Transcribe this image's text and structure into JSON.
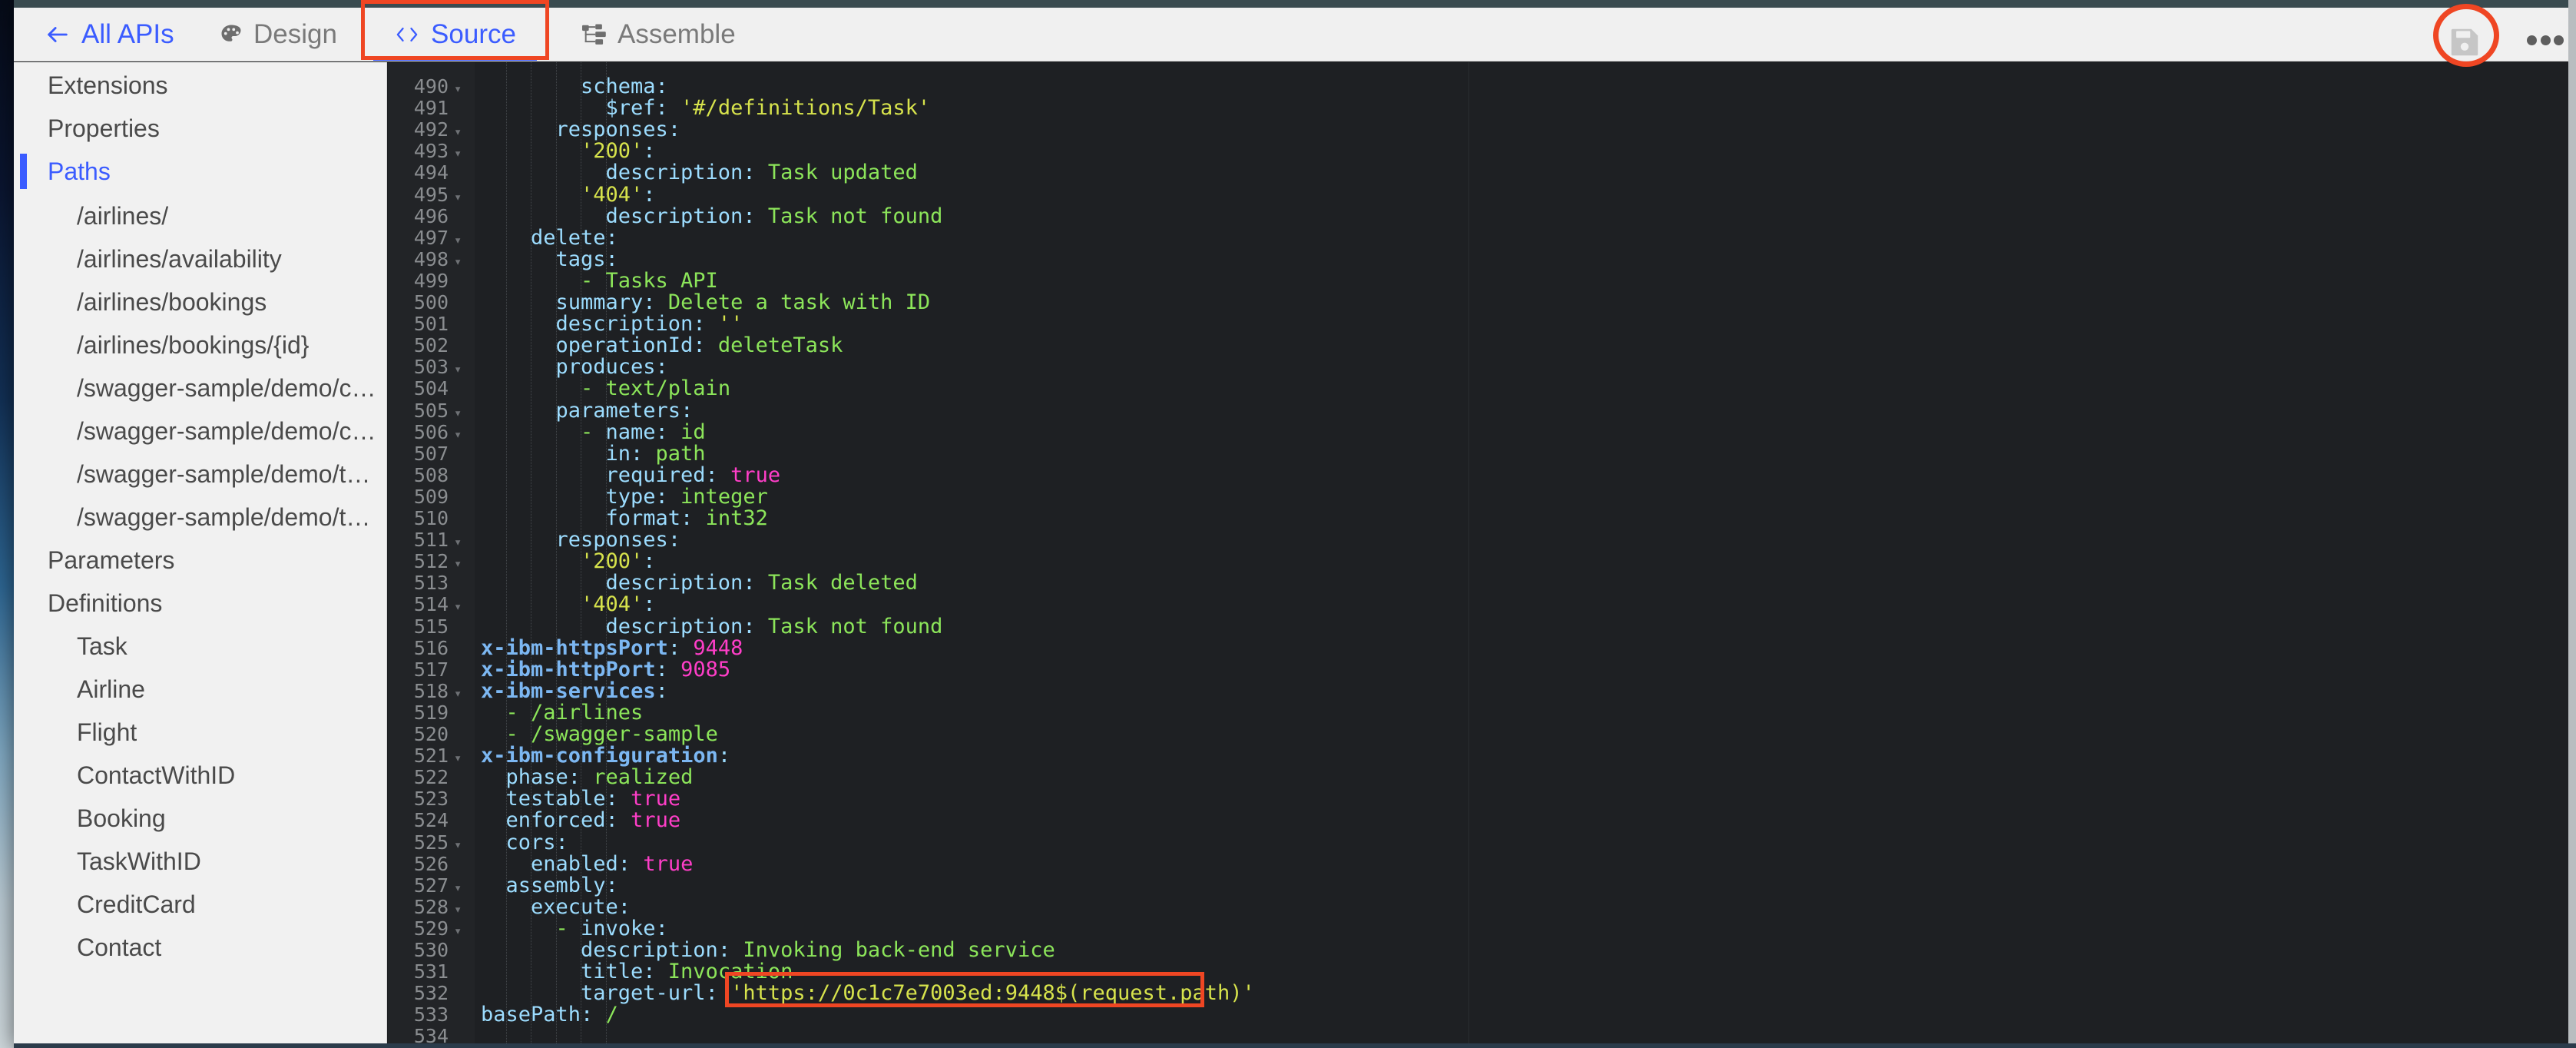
{
  "header": {
    "back_label": "All APIs",
    "tabs": [
      {
        "label": "Design",
        "icon": "palette-icon",
        "active": false
      },
      {
        "label": "Source",
        "icon": "code-icon",
        "active": true
      },
      {
        "label": "Assemble",
        "icon": "sitemap-icon",
        "active": false
      }
    ],
    "save_icon": "save-icon",
    "more_icon": "more-options-icon",
    "accent_color": "#3b5cff",
    "annotation_color": "#ef4623"
  },
  "sidebar": {
    "items": [
      {
        "label": "Extensions",
        "level": 1,
        "selected": false
      },
      {
        "label": "Properties",
        "level": 1,
        "selected": false
      },
      {
        "label": "Paths",
        "level": 1,
        "selected": true
      },
      {
        "label": "/airlines/",
        "level": 2,
        "selected": false
      },
      {
        "label": "/airlines/availability",
        "level": 2,
        "selected": false
      },
      {
        "label": "/airlines/bookings",
        "level": 2,
        "selected": false
      },
      {
        "label": "/airlines/bookings/{id}",
        "level": 2,
        "selected": false
      },
      {
        "label": "/swagger-sample/demo/contacts",
        "level": 2,
        "selected": false
      },
      {
        "label": "/swagger-sample/demo/contac…",
        "level": 2,
        "selected": false
      },
      {
        "label": "/swagger-sample/demo/tasks",
        "level": 2,
        "selected": false
      },
      {
        "label": "/swagger-sample/demo/tasks/{…",
        "level": 2,
        "selected": false
      },
      {
        "label": "Parameters",
        "level": 1,
        "selected": false
      },
      {
        "label": "Definitions",
        "level": 1,
        "selected": false
      },
      {
        "label": "Task",
        "level": 2,
        "selected": false
      },
      {
        "label": "Airline",
        "level": 2,
        "selected": false
      },
      {
        "label": "Flight",
        "level": 2,
        "selected": false
      },
      {
        "label": "ContactWithID",
        "level": 2,
        "selected": false
      },
      {
        "label": "Booking",
        "level": 2,
        "selected": false
      },
      {
        "label": "TaskWithID",
        "level": 2,
        "selected": false
      },
      {
        "label": "CreditCard",
        "level": 2,
        "selected": false
      },
      {
        "label": "Contact",
        "level": 2,
        "selected": false
      }
    ]
  },
  "editor": {
    "language": "yaml",
    "first_line": 490,
    "last_line": 534,
    "highlighted_value": "'https://0c1c7e7003ed:9448$(request.path)'",
    "lines": [
      {
        "n": 490,
        "fold": true,
        "indent": 4,
        "tokens": [
          [
            "k",
            "schema"
          ],
          [
            "p",
            ":"
          ]
        ]
      },
      {
        "n": 491,
        "fold": false,
        "indent": 5,
        "tokens": [
          [
            "k",
            "$ref"
          ],
          [
            "p",
            ": "
          ],
          [
            "q",
            "'#/definitions/Task'"
          ]
        ]
      },
      {
        "n": 492,
        "fold": true,
        "indent": 3,
        "tokens": [
          [
            "k",
            "responses"
          ],
          [
            "p",
            ":"
          ]
        ]
      },
      {
        "n": 493,
        "fold": true,
        "indent": 4,
        "tokens": [
          [
            "q",
            "'200'"
          ],
          [
            "p",
            ":"
          ]
        ]
      },
      {
        "n": 494,
        "fold": false,
        "indent": 5,
        "tokens": [
          [
            "k",
            "description"
          ],
          [
            "p",
            ": "
          ],
          [
            "s",
            "Task updated"
          ]
        ]
      },
      {
        "n": 495,
        "fold": true,
        "indent": 4,
        "tokens": [
          [
            "q",
            "'404'"
          ],
          [
            "p",
            ":"
          ]
        ]
      },
      {
        "n": 496,
        "fold": false,
        "indent": 5,
        "tokens": [
          [
            "k",
            "description"
          ],
          [
            "p",
            ": "
          ],
          [
            "s",
            "Task not found"
          ]
        ]
      },
      {
        "n": 497,
        "fold": true,
        "indent": 2,
        "tokens": [
          [
            "k",
            "delete"
          ],
          [
            "p",
            ":"
          ]
        ]
      },
      {
        "n": 498,
        "fold": true,
        "indent": 3,
        "tokens": [
          [
            "k",
            "tags"
          ],
          [
            "p",
            ":"
          ]
        ]
      },
      {
        "n": 499,
        "fold": false,
        "indent": 4,
        "tokens": [
          [
            "d",
            "- "
          ],
          [
            "s",
            "Tasks API"
          ]
        ]
      },
      {
        "n": 500,
        "fold": false,
        "indent": 3,
        "tokens": [
          [
            "k",
            "summary"
          ],
          [
            "p",
            ": "
          ],
          [
            "s",
            "Delete a task with ID"
          ]
        ]
      },
      {
        "n": 501,
        "fold": false,
        "indent": 3,
        "tokens": [
          [
            "k",
            "description"
          ],
          [
            "p",
            ": "
          ],
          [
            "q",
            "''"
          ]
        ]
      },
      {
        "n": 502,
        "fold": false,
        "indent": 3,
        "tokens": [
          [
            "k",
            "operationId"
          ],
          [
            "p",
            ": "
          ],
          [
            "s",
            "deleteTask"
          ]
        ]
      },
      {
        "n": 503,
        "fold": true,
        "indent": 3,
        "tokens": [
          [
            "k",
            "produces"
          ],
          [
            "p",
            ":"
          ]
        ]
      },
      {
        "n": 504,
        "fold": false,
        "indent": 4,
        "tokens": [
          [
            "d",
            "- "
          ],
          [
            "s",
            "text/plain"
          ]
        ]
      },
      {
        "n": 505,
        "fold": true,
        "indent": 3,
        "tokens": [
          [
            "k",
            "parameters"
          ],
          [
            "p",
            ":"
          ]
        ]
      },
      {
        "n": 506,
        "fold": true,
        "indent": 4,
        "tokens": [
          [
            "d",
            "- "
          ],
          [
            "k",
            "name"
          ],
          [
            "p",
            ": "
          ],
          [
            "s",
            "id"
          ]
        ]
      },
      {
        "n": 507,
        "fold": false,
        "indent": 5,
        "tokens": [
          [
            "k",
            "in"
          ],
          [
            "p",
            ": "
          ],
          [
            "s",
            "path"
          ]
        ]
      },
      {
        "n": 508,
        "fold": false,
        "indent": 5,
        "tokens": [
          [
            "k",
            "required"
          ],
          [
            "p",
            ": "
          ],
          [
            "n",
            "true"
          ]
        ]
      },
      {
        "n": 509,
        "fold": false,
        "indent": 5,
        "tokens": [
          [
            "k",
            "type"
          ],
          [
            "p",
            ": "
          ],
          [
            "s",
            "integer"
          ]
        ]
      },
      {
        "n": 510,
        "fold": false,
        "indent": 5,
        "tokens": [
          [
            "k",
            "format"
          ],
          [
            "p",
            ": "
          ],
          [
            "s",
            "int32"
          ]
        ]
      },
      {
        "n": 511,
        "fold": true,
        "indent": 3,
        "tokens": [
          [
            "k",
            "responses"
          ],
          [
            "p",
            ":"
          ]
        ]
      },
      {
        "n": 512,
        "fold": true,
        "indent": 4,
        "tokens": [
          [
            "q",
            "'200'"
          ],
          [
            "p",
            ":"
          ]
        ]
      },
      {
        "n": 513,
        "fold": false,
        "indent": 5,
        "tokens": [
          [
            "k",
            "description"
          ],
          [
            "p",
            ": "
          ],
          [
            "s",
            "Task deleted"
          ]
        ]
      },
      {
        "n": 514,
        "fold": true,
        "indent": 4,
        "tokens": [
          [
            "q",
            "'404'"
          ],
          [
            "p",
            ":"
          ]
        ]
      },
      {
        "n": 515,
        "fold": false,
        "indent": 5,
        "tokens": [
          [
            "k",
            "description"
          ],
          [
            "p",
            ": "
          ],
          [
            "s",
            "Task not found"
          ]
        ]
      },
      {
        "n": 516,
        "fold": false,
        "indent": 0,
        "tokens": [
          [
            "kx",
            "x-ibm-httpsPort"
          ],
          [
            "p",
            ": "
          ],
          [
            "n",
            "9448"
          ]
        ]
      },
      {
        "n": 517,
        "fold": false,
        "indent": 0,
        "tokens": [
          [
            "kx",
            "x-ibm-httpPort"
          ],
          [
            "p",
            ": "
          ],
          [
            "n",
            "9085"
          ]
        ]
      },
      {
        "n": 518,
        "fold": true,
        "indent": 0,
        "tokens": [
          [
            "kx",
            "x-ibm-services"
          ],
          [
            "p",
            ":"
          ]
        ]
      },
      {
        "n": 519,
        "fold": false,
        "indent": 1,
        "tokens": [
          [
            "d",
            "- "
          ],
          [
            "s",
            "/airlines"
          ]
        ]
      },
      {
        "n": 520,
        "fold": false,
        "indent": 1,
        "tokens": [
          [
            "d",
            "- "
          ],
          [
            "s",
            "/swagger-sample"
          ]
        ]
      },
      {
        "n": 521,
        "fold": true,
        "indent": 0,
        "tokens": [
          [
            "kx",
            "x-ibm-configuration"
          ],
          [
            "p",
            ":"
          ]
        ]
      },
      {
        "n": 522,
        "fold": false,
        "indent": 1,
        "tokens": [
          [
            "k",
            "phase"
          ],
          [
            "p",
            ": "
          ],
          [
            "s",
            "realized"
          ]
        ]
      },
      {
        "n": 523,
        "fold": false,
        "indent": 1,
        "tokens": [
          [
            "k",
            "testable"
          ],
          [
            "p",
            ": "
          ],
          [
            "n",
            "true"
          ]
        ]
      },
      {
        "n": 524,
        "fold": false,
        "indent": 1,
        "tokens": [
          [
            "k",
            "enforced"
          ],
          [
            "p",
            ": "
          ],
          [
            "n",
            "true"
          ]
        ]
      },
      {
        "n": 525,
        "fold": true,
        "indent": 1,
        "tokens": [
          [
            "k",
            "cors"
          ],
          [
            "p",
            ":"
          ]
        ]
      },
      {
        "n": 526,
        "fold": false,
        "indent": 2,
        "tokens": [
          [
            "k",
            "enabled"
          ],
          [
            "p",
            ": "
          ],
          [
            "n",
            "true"
          ]
        ]
      },
      {
        "n": 527,
        "fold": true,
        "indent": 1,
        "tokens": [
          [
            "k",
            "assembly"
          ],
          [
            "p",
            ":"
          ]
        ]
      },
      {
        "n": 528,
        "fold": true,
        "indent": 2,
        "tokens": [
          [
            "k",
            "execute"
          ],
          [
            "p",
            ":"
          ]
        ]
      },
      {
        "n": 529,
        "fold": true,
        "indent": 3,
        "tokens": [
          [
            "d",
            "- "
          ],
          [
            "k",
            "invoke"
          ],
          [
            "p",
            ":"
          ]
        ]
      },
      {
        "n": 530,
        "fold": false,
        "indent": 4,
        "tokens": [
          [
            "k",
            "description"
          ],
          [
            "p",
            ": "
          ],
          [
            "s",
            "Invoking back-end service"
          ]
        ]
      },
      {
        "n": 531,
        "fold": false,
        "indent": 4,
        "tokens": [
          [
            "k",
            "title"
          ],
          [
            "p",
            ": "
          ],
          [
            "s",
            "Invocation"
          ]
        ]
      },
      {
        "n": 532,
        "fold": false,
        "indent": 4,
        "tokens": [
          [
            "k",
            "target-url"
          ],
          [
            "p",
            ": "
          ],
          [
            "q",
            "'https://0c1c7e7003ed:9448$(request.path)'"
          ]
        ]
      },
      {
        "n": 533,
        "fold": false,
        "indent": 0,
        "tokens": [
          [
            "k",
            "basePath"
          ],
          [
            "p",
            ": "
          ],
          [
            "s",
            "/"
          ]
        ]
      },
      {
        "n": 534,
        "fold": false,
        "indent": 0,
        "tokens": []
      }
    ]
  }
}
